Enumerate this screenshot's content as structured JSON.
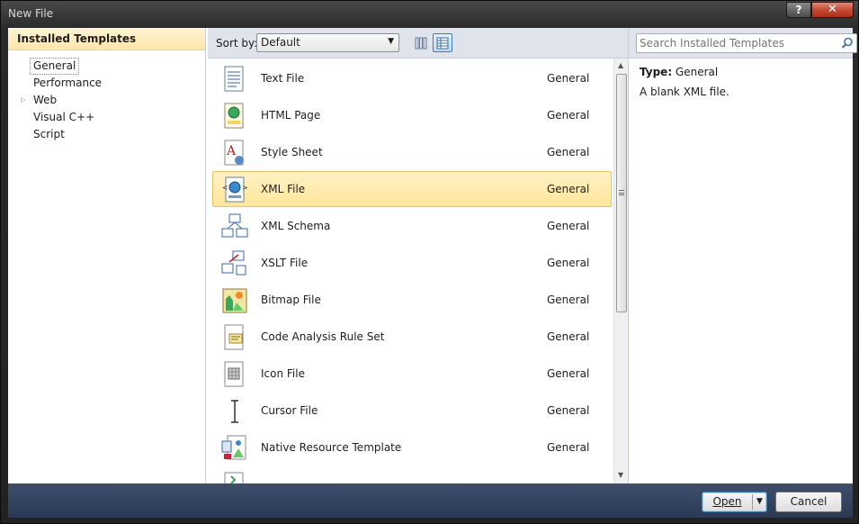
{
  "window": {
    "title": "New File",
    "help_label": "?",
    "close_label": "✕"
  },
  "left": {
    "header": "Installed Templates",
    "items": [
      {
        "label": "General",
        "selected": true,
        "expandable": false
      },
      {
        "label": "Performance",
        "selected": false,
        "expandable": false
      },
      {
        "label": "Web",
        "selected": false,
        "expandable": true
      },
      {
        "label": "Visual C++",
        "selected": false,
        "expandable": false
      },
      {
        "label": "Script",
        "selected": false,
        "expandable": false
      }
    ]
  },
  "toolbar": {
    "sort_label": "Sort by:",
    "sort_value": "Default",
    "view_modes": [
      "small-icons-view",
      "details-view"
    ]
  },
  "search": {
    "placeholder": "Search Installed Templates"
  },
  "templates": [
    {
      "name": "Text File",
      "category": "General",
      "icon": "text-file-icon"
    },
    {
      "name": "HTML Page",
      "category": "General",
      "icon": "html-page-icon"
    },
    {
      "name": "Style Sheet",
      "category": "General",
      "icon": "style-sheet-icon"
    },
    {
      "name": "XML File",
      "category": "General",
      "icon": "xml-file-icon",
      "selected": true
    },
    {
      "name": "XML Schema",
      "category": "General",
      "icon": "xml-schema-icon"
    },
    {
      "name": "XSLT File",
      "category": "General",
      "icon": "xslt-file-icon"
    },
    {
      "name": "Bitmap File",
      "category": "General",
      "icon": "bitmap-file-icon"
    },
    {
      "name": "Code Analysis Rule Set",
      "category": "General",
      "icon": "rule-set-icon"
    },
    {
      "name": "Icon File",
      "category": "General",
      "icon": "icon-file-icon"
    },
    {
      "name": "Cursor File",
      "category": "General",
      "icon": "cursor-file-icon"
    },
    {
      "name": "Native Resource Template",
      "category": "General",
      "icon": "resource-template-icon"
    }
  ],
  "details": {
    "type_label": "Type:",
    "type_value": "General",
    "description": "A blank XML file."
  },
  "buttons": {
    "open": "Open",
    "cancel": "Cancel"
  },
  "colors": {
    "selection": "#ffe69a",
    "header": "#fde6a8",
    "toolbar": "#dfe3eb",
    "bottom_bar": "#2b3953"
  }
}
